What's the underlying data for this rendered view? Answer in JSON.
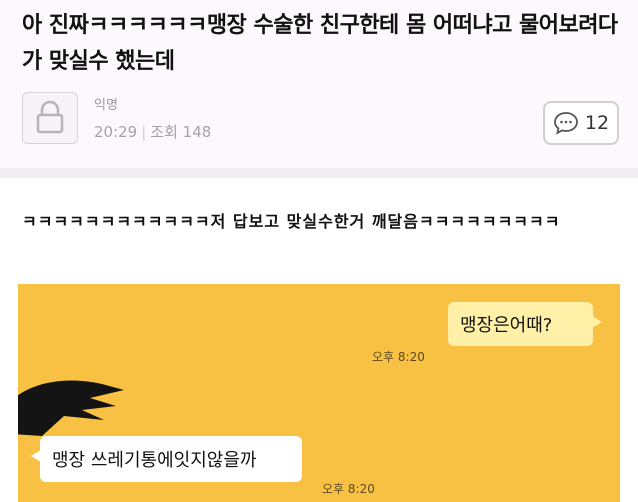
{
  "post": {
    "title": "아 진짜ㅋㅋㅋㅋㅋㅋ맹장 수술한 친구한테 몸 어떠냐고 물어보려다가 맞실수 했는데",
    "author": "익명",
    "time": "20:29",
    "views": "조회 148",
    "comment_count": "12"
  },
  "body_text": "ㅋㅋㅋㅋㅋㅋㅋㅋㅋㅋㅋㅋ저 답보고 맞실수한거 깨달음ㅋㅋㅋㅋㅋㅋㅋㅋㅋ",
  "chat": {
    "sent_message": "맹장은어때?",
    "sent_time": "오후 8:20",
    "received_message": "맹장 쓰레기통에잇지않을까",
    "received_time": "오후 8:20"
  },
  "icons": {
    "avatar": "lock-icon",
    "comment": "speech-bubble-icon"
  },
  "colors": {
    "chat_background": "#f8c144",
    "sent_bubble": "#fff0a8",
    "received_bubble": "#ffffff"
  }
}
